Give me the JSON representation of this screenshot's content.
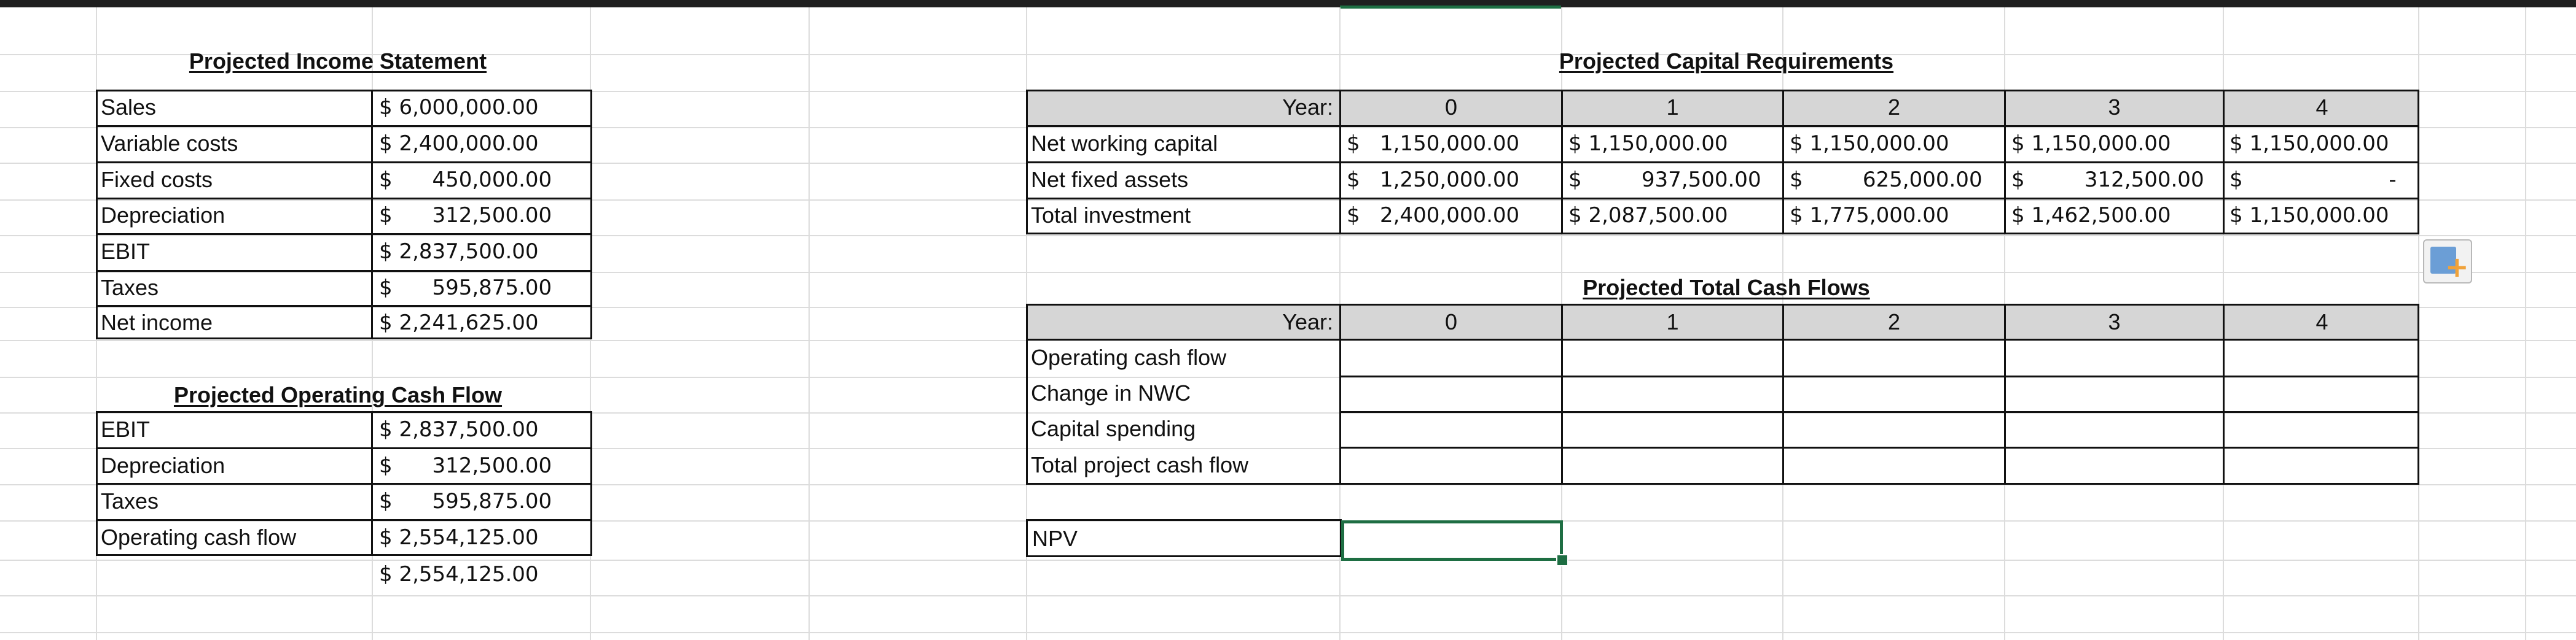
{
  "income_statement": {
    "title": "Projected Income Statement",
    "rows": [
      {
        "label": "Sales",
        "value": "$ 6,000,000.00"
      },
      {
        "label": "Variable costs",
        "value": "$ 2,400,000.00"
      },
      {
        "label": "Fixed costs",
        "value": "$      450,000.00"
      },
      {
        "label": "Depreciation",
        "value": "$      312,500.00"
      },
      {
        "label": "EBIT",
        "value": "$ 2,837,500.00"
      },
      {
        "label": "Taxes",
        "value": "$      595,875.00"
      },
      {
        "label": "Net income",
        "value": "$ 2,241,625.00"
      }
    ]
  },
  "operating_cash_flow": {
    "title": "Projected Operating Cash Flow",
    "rows": [
      {
        "label": "EBIT",
        "value": "$ 2,837,500.00"
      },
      {
        "label": "Depreciation",
        "value": "$      312,500.00"
      },
      {
        "label": "Taxes",
        "value": "$      595,875.00"
      },
      {
        "label": "Operating cash flow",
        "value": "$ 2,554,125.00"
      }
    ],
    "extra_value": "$ 2,554,125.00"
  },
  "capital_requirements": {
    "title": "Projected Capital Requirements",
    "year_label": "Year:",
    "years": [
      "0",
      "1",
      "2",
      "3",
      "4"
    ],
    "rows": [
      {
        "label": "Net working capital",
        "values": [
          "$   1,150,000.00",
          "$ 1,150,000.00",
          "$ 1,150,000.00",
          "$ 1,150,000.00",
          "$ 1,150,000.00"
        ]
      },
      {
        "label": "Net fixed assets",
        "values": [
          "$   1,250,000.00",
          "$         937,500.00",
          "$         625,000.00",
          "$         312,500.00",
          "$                      -"
        ]
      },
      {
        "label": "Total investment",
        "values": [
          "$   2,400,000.00",
          "$ 2,087,500.00",
          "$ 1,775,000.00",
          "$ 1,462,500.00",
          "$ 1,150,000.00"
        ]
      }
    ]
  },
  "total_cash_flows": {
    "title": "Projected Total Cash Flows",
    "year_label": "Year:",
    "years": [
      "0",
      "1",
      "2",
      "3",
      "4"
    ],
    "rows": [
      {
        "label": "Operating cash flow"
      },
      {
        "label": "Change in NWC"
      },
      {
        "label": "Capital spending"
      },
      {
        "label": "Total project cash flow"
      }
    ]
  },
  "npv": {
    "label": "NPV",
    "value": ""
  },
  "colors": {
    "header_fill": "#d6d6d6",
    "selection": "#1e6e43",
    "gridline": "#dcdcdc"
  },
  "icons": {
    "paste_options": "paste-options-icon"
  }
}
